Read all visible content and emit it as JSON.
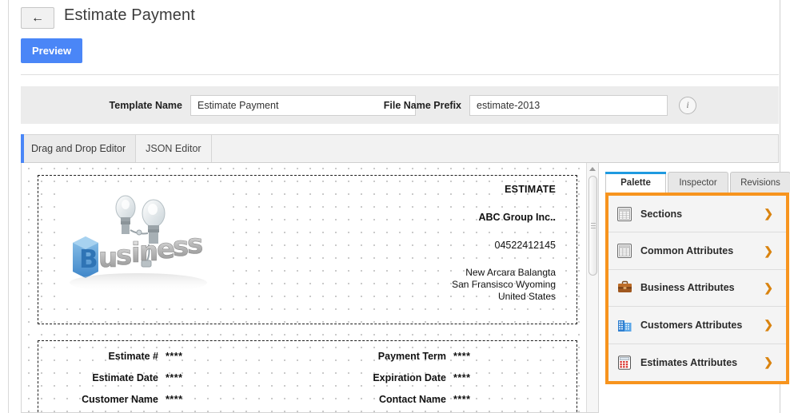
{
  "header": {
    "back_icon": "arrow-left-icon",
    "title": "Estimate Payment",
    "preview_label": "Preview"
  },
  "meta": {
    "template_name_label": "Template Name",
    "template_name_value": "Estimate Payment",
    "file_prefix_label": "File Name Prefix",
    "file_prefix_value": "estimate-2013",
    "info_icon": "info-icon",
    "info_glyph": "i"
  },
  "editor_tabs": [
    {
      "label": "Drag and Drop Editor",
      "active": true
    },
    {
      "label": "JSON Editor",
      "active": false
    }
  ],
  "document": {
    "logo_alt": "business-logo-image",
    "brand": {
      "estimate_heading": "ESTIMATE",
      "company": "ABC Group Inc..",
      "phone": "04522412145",
      "address_line1": "New Arcara Balangta",
      "address_line2": "San Fransisco  Wyoming",
      "address_line3": "United States"
    },
    "fields_left": [
      {
        "label": "Estimate #",
        "value": "****"
      },
      {
        "label": "Estimate Date",
        "value": "****"
      },
      {
        "label": "Customer Name",
        "value": "****"
      }
    ],
    "fields_right": [
      {
        "label": "Payment Term",
        "value": "****"
      },
      {
        "label": "Expiration Date",
        "value": "****"
      },
      {
        "label": "Contact Name",
        "value": "****"
      }
    ]
  },
  "palette": {
    "tabs": [
      {
        "label": "Palette",
        "active": true
      },
      {
        "label": "Inspector",
        "active": false
      },
      {
        "label": "Revisions",
        "active": false
      }
    ],
    "highlight_color": "#f7941e",
    "chevron": "❯",
    "items": [
      {
        "label": "Sections",
        "icon": "grid-table-icon"
      },
      {
        "label": "Common Attributes",
        "icon": "grid-table-icon"
      },
      {
        "label": "Business Attributes",
        "icon": "briefcase-icon"
      },
      {
        "label": "Customers Attributes",
        "icon": "building-icon"
      },
      {
        "label": "Estimates Attributes",
        "icon": "calculator-icon"
      }
    ]
  }
}
